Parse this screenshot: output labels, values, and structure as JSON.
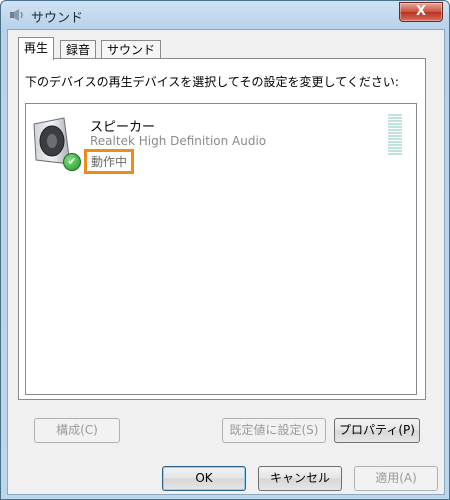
{
  "window": {
    "title": "サウンド",
    "close_label": "X"
  },
  "tabs": [
    {
      "label": "再生",
      "active": true
    },
    {
      "label": "録音",
      "active": false
    },
    {
      "label": "サウンド",
      "active": false
    }
  ],
  "panel": {
    "instruction": "下のデバイスの再生デバイスを選択してその設定を変更してください:",
    "devices": [
      {
        "name": "スピーカー",
        "driver": "Realtek High Definition Audio",
        "status": "動作中",
        "icon": "speaker-icon",
        "status_icon": "check-icon"
      }
    ]
  },
  "panel_buttons": {
    "configure": "構成(C)",
    "set_default": "既定値に設定(S)",
    "properties": "プロパティ(P)"
  },
  "dialog_buttons": {
    "ok": "OK",
    "cancel": "キャンセル",
    "apply": "適用(A)"
  },
  "colors": {
    "highlight_border": "#f08a1c",
    "title_gradient_top": "#cfe3f3",
    "close_button": "#c9503e"
  }
}
